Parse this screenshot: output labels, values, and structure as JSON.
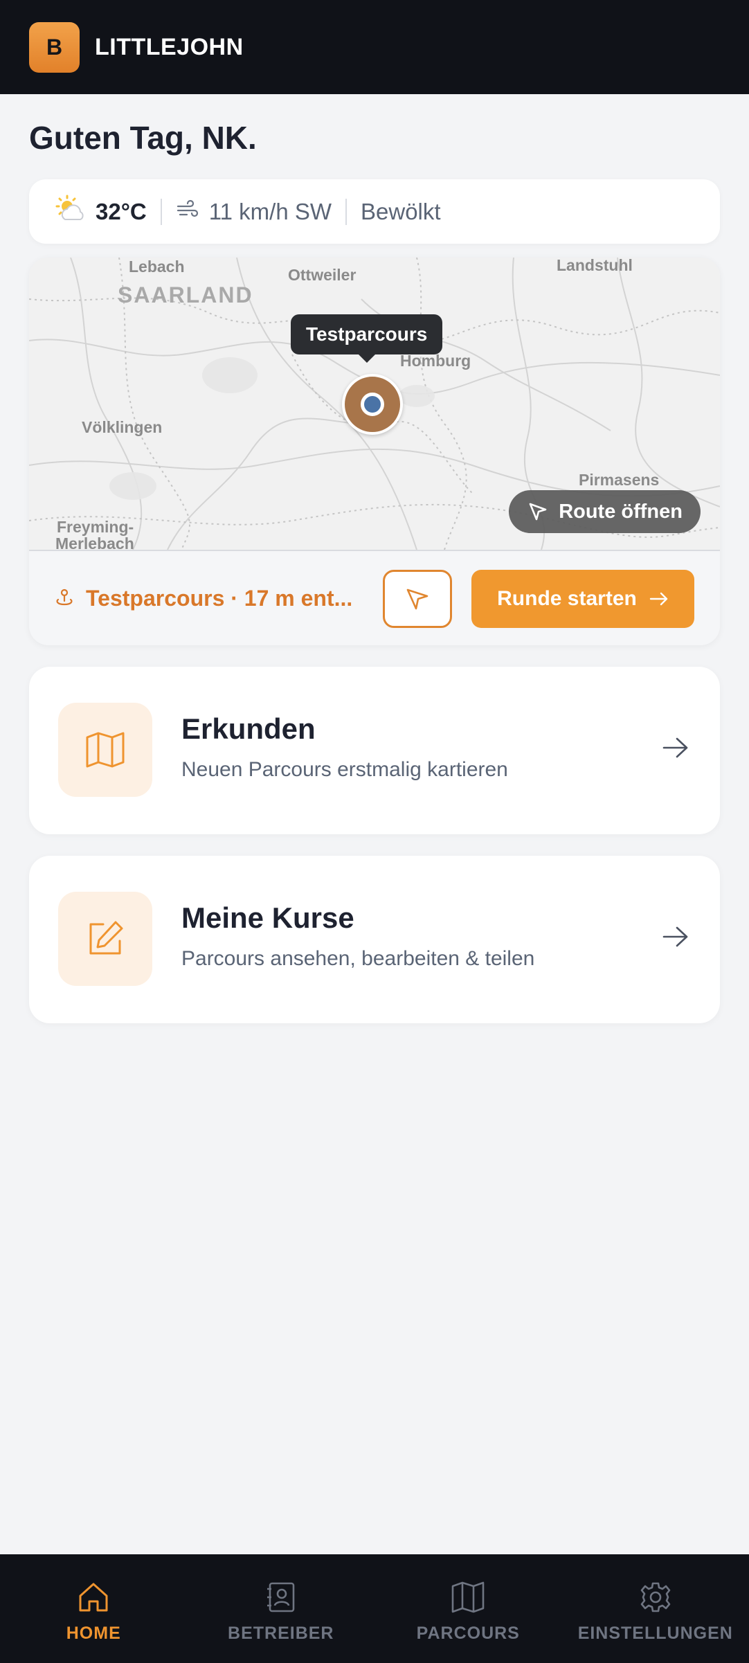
{
  "header": {
    "logo_letter": "B",
    "app_name": "LITTLEJOHN"
  },
  "greeting": "Guten Tag, NK.",
  "weather": {
    "icon": "partly-cloudy-sun-icon",
    "temperature": "32°C",
    "wind_icon": "wind-icon",
    "wind": "11 km/h SW",
    "condition": "Bewölkt"
  },
  "map": {
    "places": {
      "lebach": "Lebach",
      "saarland": "SAARLAND",
      "ottweiler": "Ottweiler",
      "landstuhl": "Landstuhl",
      "homburg": "Homburg",
      "voelklingen": "Völklingen",
      "pirmasens": "Pirmasens",
      "freyming": "Freyming-",
      "merlebach": "Merlebach"
    },
    "marker_tooltip": "Testparcours",
    "route_button": "Route öffnen"
  },
  "course": {
    "icon": "location-pin-icon",
    "label": "Testparcours · 17 m ent...",
    "navigate_icon": "navigation-arrow-icon",
    "start_button": "Runde starten"
  },
  "actions": [
    {
      "icon": "map-icon",
      "title": "Erkunden",
      "subtitle": "Neuen Parcours erstmalig kartieren"
    },
    {
      "icon": "edit-icon",
      "title": "Meine Kurse",
      "subtitle": "Parcours ansehen, bearbeiten & teilen"
    }
  ],
  "bottom_nav": [
    {
      "label": "HOME",
      "icon": "home-icon",
      "active": true
    },
    {
      "label": "BETREIBER",
      "icon": "contacts-icon",
      "active": false
    },
    {
      "label": "PARCOURS",
      "icon": "map-icon",
      "active": false
    },
    {
      "label": "EINSTELLUNGEN",
      "icon": "gear-icon",
      "active": false
    }
  ],
  "colors": {
    "accent": "#f0982f",
    "accent_text": "#d9782a",
    "dark": "#101218",
    "background": "#f3f4f6"
  }
}
